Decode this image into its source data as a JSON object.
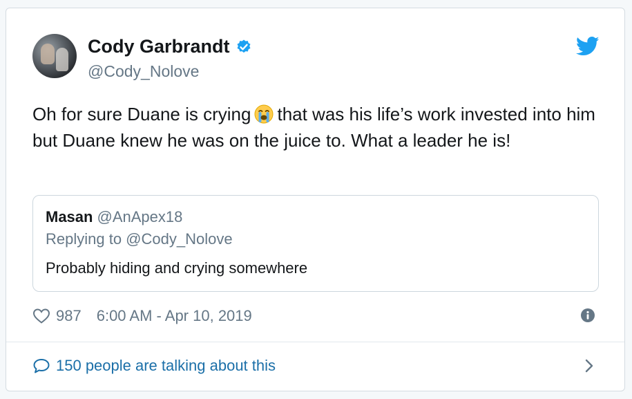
{
  "tweet": {
    "author_name": "Cody Garbrandt",
    "author_handle": "@Cody_Nolove",
    "text_before_emoji": "Oh for sure Duane is crying",
    "emoji": "loudly-crying-face",
    "text_after_emoji": "that was his life’s work invested into him but Duane knew he was on the juice to. What a leader he is!",
    "likes": "987",
    "timestamp": "6:00 AM - Apr 10, 2019",
    "talking": "150 people are talking about this"
  },
  "quote": {
    "name": "Masan",
    "handle": "@AnApex18",
    "replying_to": "Replying to @Cody_Nolove",
    "text": "Probably hiding and crying somewhere"
  },
  "colors": {
    "twitter_blue": "#1da1f2",
    "link_blue": "#1b6fa8",
    "secondary_text": "#657786",
    "primary_text": "#14171a"
  },
  "icons": [
    "verified-badge-icon",
    "twitter-bird-icon",
    "heart-icon",
    "info-icon",
    "comment-icon",
    "chevron-right-icon",
    "loudly-crying-face-emoji"
  ]
}
